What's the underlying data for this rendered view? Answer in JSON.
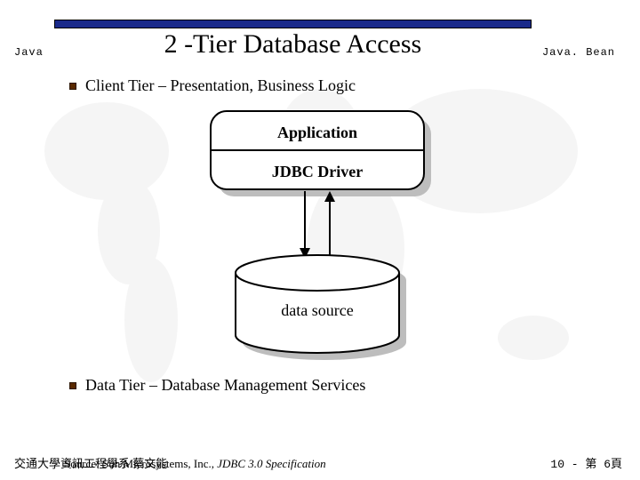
{
  "header": {
    "left": "Java",
    "title": "2 -Tier Database Access",
    "right": "Java. Bean"
  },
  "bullets": [
    "Client Tier – Presentation, Business Logic",
    "Data Tier – Database Management Services"
  ],
  "diagram": {
    "box_top": "Application",
    "box_bottom": "JDBC Driver",
    "cylinder": "data source"
  },
  "footer": {
    "left": "交通大學資訊工程學系 蔡文能",
    "source_prefix": "Source: Sun Microsystems, Inc., ",
    "source_ital": "JDBC 3.0 Specification",
    "right": "10 - 第 6頁"
  }
}
